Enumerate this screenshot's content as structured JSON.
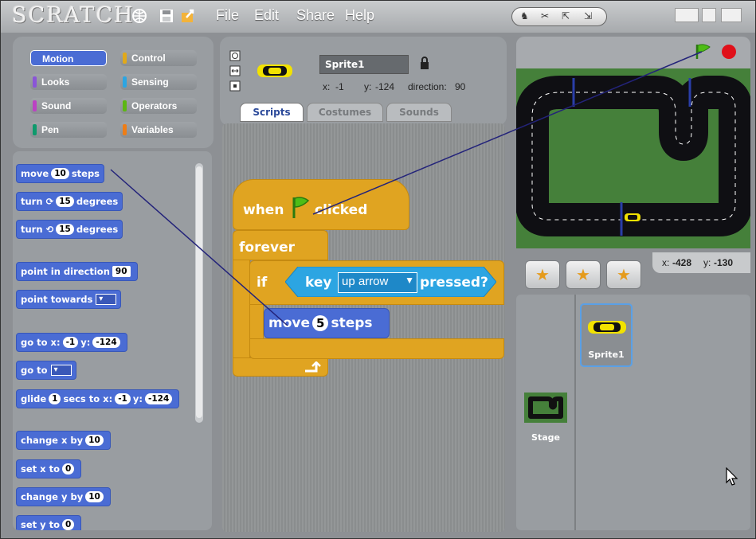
{
  "topbar": {
    "logo": "SCRATCH",
    "menus": [
      "File",
      "Edit",
      "Share",
      "Help"
    ]
  },
  "categories": [
    {
      "label": "Motion",
      "color": "#4a6cd4",
      "selected": true
    },
    {
      "label": "Control",
      "color": "#e1a91a"
    },
    {
      "label": "Looks",
      "color": "#8a55d7"
    },
    {
      "label": "Sensing",
      "color": "#2ca5e2"
    },
    {
      "label": "Sound",
      "color": "#bb42c3"
    },
    {
      "label": "Operators",
      "color": "#5cb712"
    },
    {
      "label": "Pen",
      "color": "#0e9a6c"
    },
    {
      "label": "Variables",
      "color": "#ee7d16"
    }
  ],
  "palette": {
    "move": {
      "prefix": "move",
      "value": "10",
      "suffix": "steps"
    },
    "turn_cw": {
      "prefix": "turn",
      "value": "15",
      "suffix": "degrees"
    },
    "turn_ccw": {
      "prefix": "turn",
      "value": "15",
      "suffix": "degrees"
    },
    "point_dir": {
      "prefix": "point in direction",
      "value": "90"
    },
    "point_towards": {
      "prefix": "point towards"
    },
    "goto_xy": {
      "prefix": "go to x:",
      "x": "-1",
      "ylabel": "y:",
      "y": "-124"
    },
    "goto": {
      "prefix": "go to"
    },
    "glide": {
      "prefix": "glide",
      "secs": "1",
      "mid": "secs to x:",
      "x": "-1",
      "ylabel": "y:",
      "y": "-124"
    },
    "change_x": {
      "prefix": "change x by",
      "value": "10"
    },
    "set_x": {
      "prefix": "set x to",
      "value": "0"
    },
    "change_y": {
      "prefix": "change y by",
      "value": "10"
    },
    "set_y": {
      "prefix": "set y to",
      "value": "0"
    }
  },
  "sprite": {
    "name": "Sprite1",
    "x_label": "x:",
    "x": "-1",
    "y_label": "y:",
    "y": "-124",
    "dir_label": "direction:",
    "direction": "90"
  },
  "tabs": [
    "Scripts",
    "Costumes",
    "Sounds"
  ],
  "script": {
    "hat_when": "when",
    "hat_clicked": "clicked",
    "forever": "forever",
    "if": "if",
    "key_label": "key",
    "key_value": "up arrow",
    "pressed": "pressed?",
    "move_prefix": "move",
    "move_value": "5",
    "move_suffix": "steps"
  },
  "stage_info": {
    "mouse_x_label": "x:",
    "mouse_x": "-428",
    "mouse_y_label": "y:",
    "mouse_y": "-130"
  },
  "sprites": {
    "sprite1_label": "Sprite1",
    "stage_label": "Stage"
  },
  "colors": {
    "motion": "#4a6cd4",
    "control": "#e0a421",
    "sensing": "#2ca5e2",
    "stage_grass": "#45803a"
  }
}
